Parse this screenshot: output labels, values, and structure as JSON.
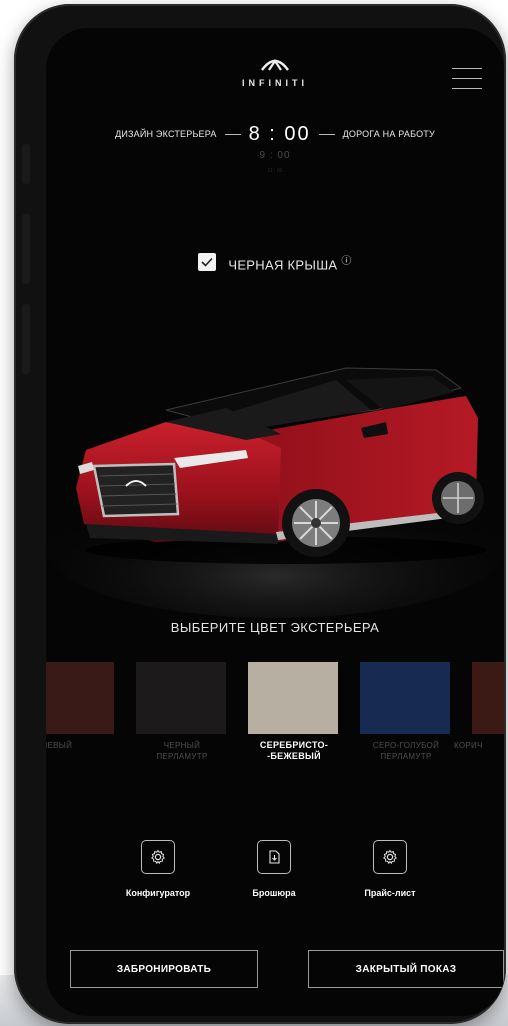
{
  "header": {
    "brand": "INFINITI",
    "logo_icon": "infiniti-logo-icon",
    "menu_icon": "hamburger-menu-icon"
  },
  "time_selector": {
    "left_label": "ДИЗАЙН ЭКСТЕРЬЕРА",
    "current_time": "8 : 00",
    "right_label": "ДОРОГА НА РАБОТУ",
    "next_time": "9 : 00",
    "next_time_2": "11 : 00"
  },
  "roof_option": {
    "label": "ЧЕРНАЯ КРЫША",
    "checked": true,
    "info_icon": "ⓘ"
  },
  "car": {
    "body_color": "#a3141f",
    "roof_color": "#0b0b0b"
  },
  "colors": {
    "title": "ВЫБЕРИТЕ ЦВЕТ ЭКСТЕРЬЕРА",
    "items": [
      {
        "label": "ЧНЕВЫЙ",
        "swatch": "#3a1a17",
        "selected": false
      },
      {
        "label": "ЧЕРНЫЙ ПЕРЛАМУТР",
        "line1": "ЧЕРНЫЙ",
        "line2": "ПЕРЛАМУТР",
        "swatch": "#1c1a1b",
        "selected": false
      },
      {
        "label": "СЕРЕБРИСТО- -БЕЖЕВЫЙ",
        "line1": "СЕРЕБРИСТО-",
        "line2": "-БЕЖЕВЫЙ",
        "swatch": "#b7b0a2",
        "selected": true
      },
      {
        "label": "СЕРО-ГОЛУБОЙ ПЕРЛАМУТР",
        "line1": "СЕРО-ГОЛУБОЙ",
        "line2": "ПЕРЛАМУТР",
        "swatch": "#172b52",
        "selected": false
      },
      {
        "label": "КОРИЧ",
        "swatch": "#3b1a15",
        "selected": false
      }
    ]
  },
  "actions": [
    {
      "label": "Конфигуратор",
      "icon": "gear-icon"
    },
    {
      "label": "Брошюра",
      "icon": "document-download-icon"
    },
    {
      "label": "Прайс-лист",
      "icon": "gear-icon"
    }
  ],
  "cta": {
    "reserve": "ЗАБРОНИРОВАТЬ",
    "private_show": "ЗАКРЫТЫЙ ПОКАЗ"
  }
}
